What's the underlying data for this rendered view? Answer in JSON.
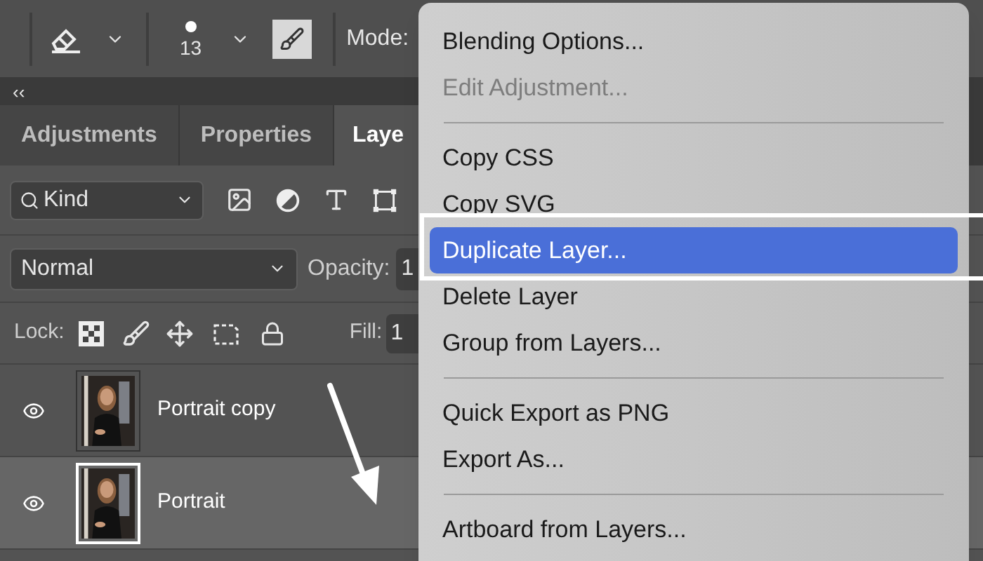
{
  "toolbar": {
    "brush_size": "13",
    "mode_label": "Mode:"
  },
  "collapse": "‹‹",
  "tabs": [
    {
      "label": "Adjustments",
      "selected": false
    },
    {
      "label": "Properties",
      "selected": false
    },
    {
      "label": "Laye",
      "selected": true
    }
  ],
  "filter": {
    "value": "Kind"
  },
  "blend": {
    "mode": "Normal",
    "opacity_label": "Opacity:",
    "opacity_value": "1"
  },
  "lock": {
    "label": "Lock:",
    "fill_label": "Fill:",
    "fill_value": "1"
  },
  "layers": [
    {
      "name": "Portrait copy",
      "visible": true,
      "selected": false
    },
    {
      "name": "Portrait",
      "visible": true,
      "selected": true
    }
  ],
  "context_menu": {
    "items": [
      {
        "kind": "item",
        "label": "Blending Options...",
        "disabled": false,
        "highlighted": false
      },
      {
        "kind": "item",
        "label": "Edit Adjustment...",
        "disabled": true,
        "highlighted": false
      },
      {
        "kind": "separator"
      },
      {
        "kind": "item",
        "label": "Copy CSS",
        "disabled": false,
        "highlighted": false
      },
      {
        "kind": "item",
        "label": "Copy SVG",
        "disabled": false,
        "highlighted": false
      },
      {
        "kind": "item",
        "label": "Duplicate Layer...",
        "disabled": false,
        "highlighted": true
      },
      {
        "kind": "item",
        "label": "Delete Layer",
        "disabled": false,
        "highlighted": false
      },
      {
        "kind": "item",
        "label": "Group from Layers...",
        "disabled": false,
        "highlighted": false
      },
      {
        "kind": "separator"
      },
      {
        "kind": "item",
        "label": "Quick Export as PNG",
        "disabled": false,
        "highlighted": false
      },
      {
        "kind": "item",
        "label": "Export As...",
        "disabled": false,
        "highlighted": false
      },
      {
        "kind": "separator"
      },
      {
        "kind": "item",
        "label": "Artboard from Layers...",
        "disabled": false,
        "highlighted": false
      }
    ]
  }
}
